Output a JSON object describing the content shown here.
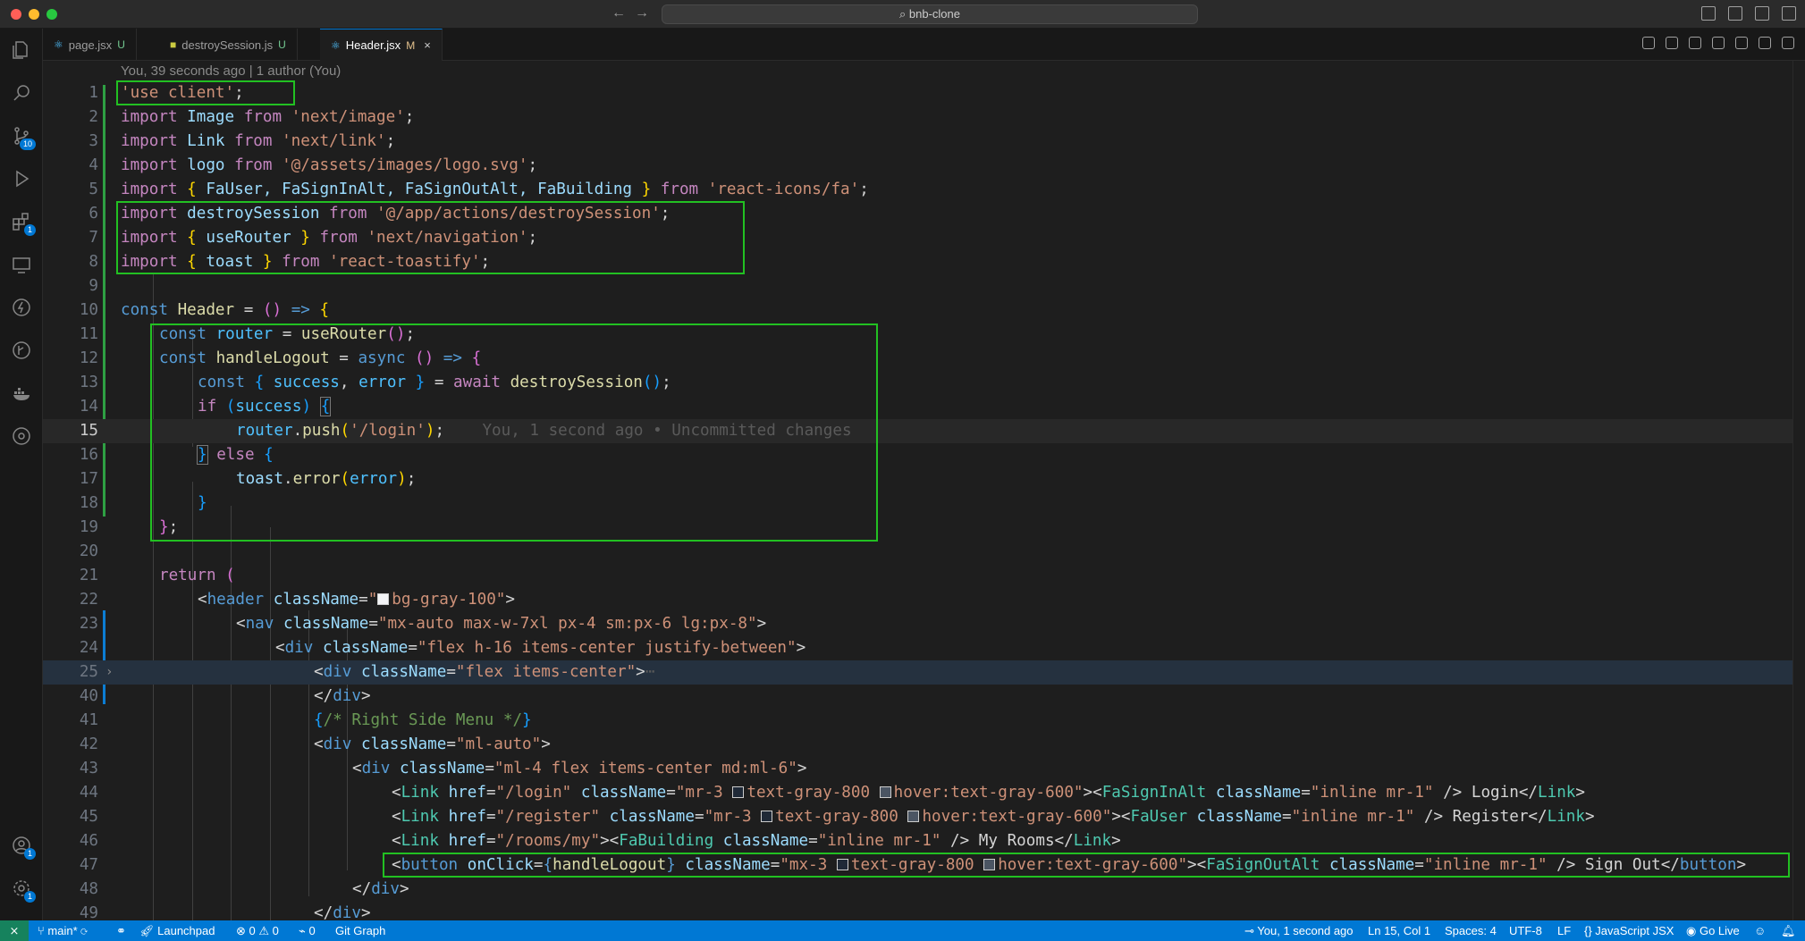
{
  "window": {
    "title": "bnb-clone",
    "search_icon": "search-icon"
  },
  "tabs": [
    {
      "label": "page.jsx",
      "status": "U",
      "icon": "react-icon"
    },
    {
      "label": "destroySession.js",
      "status": "U",
      "icon": "js-icon"
    },
    {
      "label": "Header.jsx",
      "status": "M",
      "icon": "react-icon",
      "active": true,
      "close": "×"
    }
  ],
  "activity_badges": {
    "source_control": "10",
    "extensions": "1",
    "accounts": "1",
    "settings": "1"
  },
  "editor": {
    "blame": "You, 39 seconds ago | 1 author (You)",
    "inline_blame": "You, 1 second ago • Uncommitted changes",
    "line_numbers": [
      "1",
      "2",
      "3",
      "4",
      "5",
      "6",
      "7",
      "8",
      "9",
      "10",
      "11",
      "12",
      "13",
      "14",
      "15",
      "16",
      "17",
      "18",
      "19",
      "20",
      "21",
      "22",
      "23",
      "24",
      "25",
      "40",
      "41",
      "42",
      "43",
      "44",
      "45",
      "46",
      "47",
      "48",
      "49"
    ],
    "fold_marker": "›",
    "ellipsis": "⋯",
    "tokens": {
      "l1": [
        "'use client'",
        ";"
      ],
      "l2": [
        "import",
        " Image ",
        "from",
        " ",
        "'next/image'",
        ";"
      ],
      "l3": [
        "import",
        " Link ",
        "from",
        " ",
        "'next/link'",
        ";"
      ],
      "l4": [
        "import",
        " logo ",
        "from",
        " ",
        "'@/assets/images/logo.svg'",
        ";"
      ],
      "l5": [
        "import",
        " ",
        "{",
        " FaUser, FaSignInAlt, FaSignOutAlt, FaBuilding ",
        "}",
        " ",
        "from",
        " ",
        "'react-icons/fa'",
        ";"
      ],
      "l6": [
        "import",
        " destroySession ",
        "from",
        " ",
        "'@/app/actions/destroySession'",
        ";"
      ],
      "l7": [
        "import",
        " ",
        "{",
        " useRouter ",
        "}",
        " ",
        "from",
        " ",
        "'next/navigation'",
        ";"
      ],
      "l8": [
        "import",
        " ",
        "{",
        " toast ",
        "}",
        " ",
        "from",
        " ",
        "'react-toastify'",
        ";"
      ],
      "l10": [
        "const",
        " ",
        "Header",
        " = ",
        "()",
        " ",
        "=>",
        " ",
        "{"
      ],
      "l11": [
        "const",
        " ",
        "router",
        " = ",
        "useRouter",
        "()",
        ";"
      ],
      "l12": [
        "const",
        " ",
        "handleLogout",
        " = ",
        "async",
        " ",
        "()",
        " ",
        "=>",
        " ",
        "{"
      ],
      "l13": [
        "const",
        " ",
        "{",
        " ",
        "success",
        ", ",
        "error",
        " ",
        "}",
        " = ",
        "await",
        " ",
        "destroySession",
        "()",
        ";"
      ],
      "l14": [
        "if",
        " ",
        "(",
        "success",
        ")",
        " ",
        "{"
      ],
      "l15": [
        "router",
        ".",
        "push",
        "(",
        "'/login'",
        ")",
        ";"
      ],
      "l16": [
        "}",
        " ",
        "else",
        " ",
        "{"
      ],
      "l17": [
        "toast",
        ".",
        "error",
        "(",
        "error",
        ")",
        ";"
      ],
      "l18": [
        "}"
      ],
      "l19": [
        "}",
        ";"
      ],
      "l21": [
        "return",
        " ",
        "("
      ],
      "l22": [
        "<",
        "header",
        " ",
        "className",
        "=",
        "\"",
        "bg-gray-100\"",
        ">"
      ],
      "l23": [
        "<",
        "nav",
        " ",
        "className",
        "=",
        "\"mx-auto max-w-7xl px-4 sm:px-6 lg:px-8\"",
        ">"
      ],
      "l24": [
        "<",
        "div",
        " ",
        "className",
        "=",
        "\"flex h-16 items-center justify-between\"",
        ">"
      ],
      "l25": [
        "<",
        "div",
        " ",
        "className",
        "=",
        "\"flex items-center\"",
        ">"
      ],
      "l40": [
        "</",
        "div",
        ">"
      ],
      "l41": [
        "{",
        "/* Right Side Menu */",
        "}"
      ],
      "l42": [
        "<",
        "div",
        " ",
        "className",
        "=",
        "\"ml-auto\"",
        ">"
      ],
      "l43": [
        "<",
        "div",
        " ",
        "className",
        "=",
        "\"ml-4 flex items-center md:ml-6\"",
        ">"
      ],
      "l44": [
        "<",
        "Link",
        " ",
        "href",
        "=",
        "\"/login\"",
        " ",
        "className",
        "=",
        "\"mr-3 ",
        "text-gray-800 ",
        "hover:text-gray-600\"",
        ">",
        "<",
        "FaSignInAlt",
        " ",
        "className",
        "=",
        "\"inline mr-1\"",
        " />",
        " Login",
        "</",
        "Link",
        ">"
      ],
      "l45": [
        "<",
        "Link",
        " ",
        "href",
        "=",
        "\"/register\"",
        " ",
        "className",
        "=",
        "\"mr-3 ",
        "text-gray-800 ",
        "hover:text-gray-600\"",
        ">",
        "<",
        "FaUser",
        " ",
        "className",
        "=",
        "\"inline mr-1\"",
        " />",
        " Register",
        "</",
        "Link",
        ">"
      ],
      "l46": [
        "<",
        "Link",
        " ",
        "href",
        "=",
        "\"/rooms/my\"",
        ">",
        "<",
        "FaBuilding",
        " ",
        "className",
        "=",
        "\"inline mr-1\"",
        " />",
        " My Rooms",
        "</",
        "Link",
        ">"
      ],
      "l47": [
        "<",
        "button",
        " ",
        "onClick",
        "=",
        "{",
        "handleLogout",
        "}",
        " ",
        "className",
        "=",
        "\"mx-3 ",
        "text-gray-800 ",
        "hover:text-gray-600\"",
        ">",
        "<",
        "FaSignOutAlt",
        " ",
        "className",
        "=",
        "\"inline mr-1\"",
        " />",
        " Sign Out",
        "</",
        "button",
        ">"
      ],
      "l48": [
        "</",
        "div",
        ">"
      ],
      "l49": [
        "</",
        "div",
        ">"
      ]
    }
  },
  "statusbar": {
    "branch": "main*",
    "launchpad": "Launchpad",
    "errors": "0",
    "warnings": "0",
    "ports": "0",
    "git_graph": "Git Graph",
    "blame": "You, 1 second ago",
    "cursor": "Ln 15, Col 1",
    "spaces": "Spaces: 4",
    "encoding": "UTF-8",
    "eol": "LF",
    "language": "JavaScript JSX",
    "go_live": "Go Live"
  },
  "colors": {
    "highlight_box": "#22c022",
    "statusbar": "#0078d4",
    "accent": "#0078d4"
  }
}
